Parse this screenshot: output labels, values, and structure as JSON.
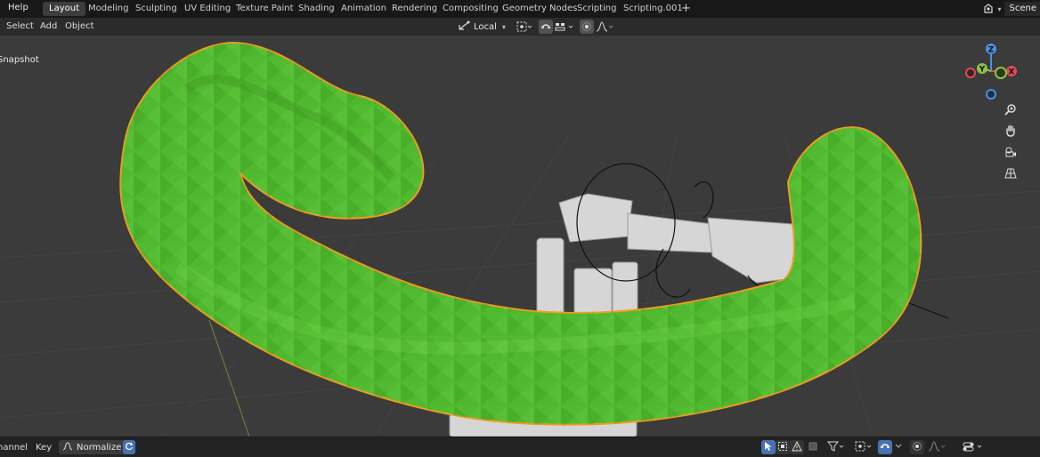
{
  "topbar": {
    "help": "Help",
    "tabs": [
      {
        "label": "Layout",
        "active": true
      },
      {
        "label": "Modeling",
        "active": false
      },
      {
        "label": "Sculpting",
        "active": false
      },
      {
        "label": "UV Editing",
        "active": false
      },
      {
        "label": "Texture Paint",
        "active": false
      },
      {
        "label": "Shading",
        "active": false
      },
      {
        "label": "Animation",
        "active": false
      },
      {
        "label": "Rendering",
        "active": false
      },
      {
        "label": "Compositing",
        "active": false
      },
      {
        "label": "Geometry Nodes",
        "active": false
      },
      {
        "label": "Scripting",
        "active": false
      },
      {
        "label": "Scripting.001",
        "active": false
      }
    ],
    "add_tab": "+",
    "scene_label": "Scene"
  },
  "viewport_header": {
    "menus": [
      "Select",
      "Add",
      "Object"
    ],
    "pivot_label": "Local"
  },
  "viewport": {
    "overlay_text": "Snapshot",
    "gizmo": {
      "z": "Z",
      "y": "Y",
      "x": "X"
    },
    "colors": {
      "background": "#3b3b3b",
      "mesh": "#4fb82e",
      "selection_outline": "#f39a1e",
      "armature": "#d6d6d6"
    }
  },
  "bottombar": {
    "menus": [
      "Channel",
      "Key"
    ],
    "normalize_label": "Normalize"
  },
  "colors": {
    "accent": "#4772b3",
    "x_axis": "#e34a55",
    "y_axis": "#8bc34a",
    "z_axis": "#4a90e2"
  }
}
